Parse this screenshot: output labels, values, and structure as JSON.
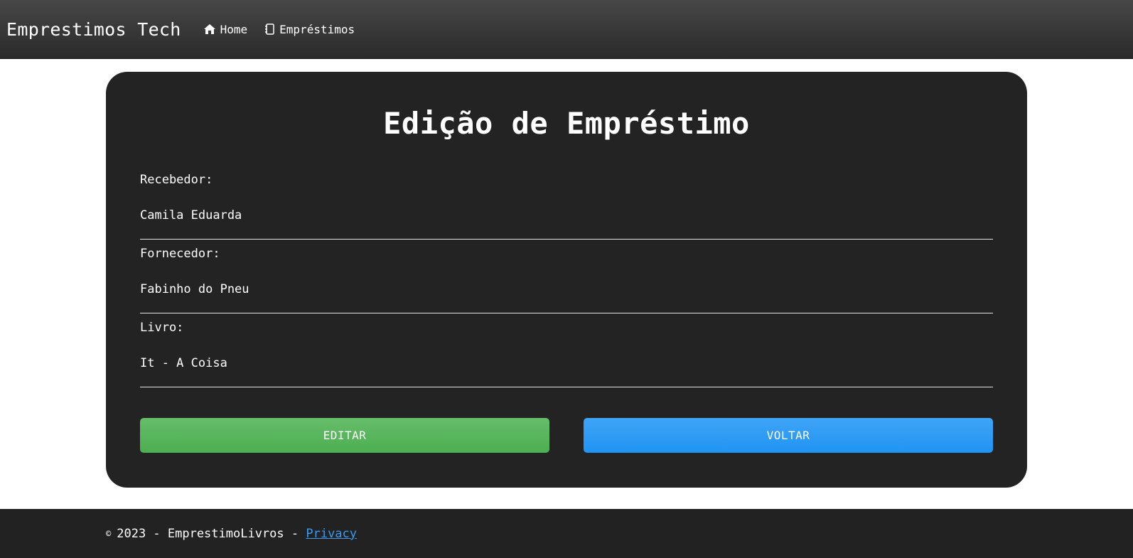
{
  "navbar": {
    "brand": "Emprestimos Tech",
    "links": [
      {
        "label": "Home",
        "icon": "home-icon"
      },
      {
        "label": "Empréstimos",
        "icon": "notebook-icon"
      }
    ]
  },
  "form": {
    "title": "Edição de Empréstimo",
    "fields": [
      {
        "label": "Recebedor:",
        "value": "Camila Eduarda"
      },
      {
        "label": "Fornecedor:",
        "value": "Fabinho do Pneu"
      },
      {
        "label": "Livro:",
        "value": "It - A Coisa"
      }
    ],
    "edit_label": "EDITAR",
    "back_label": "VOLTAR"
  },
  "footer": {
    "copyright_symbol": "©",
    "text": "2023 - EmprestimoLivros -",
    "privacy_label": "Privacy"
  },
  "colors": {
    "edit_button": "#4caf50",
    "back_button": "#2196f3",
    "card_background": "#232323",
    "link": "#3a9bf0"
  }
}
